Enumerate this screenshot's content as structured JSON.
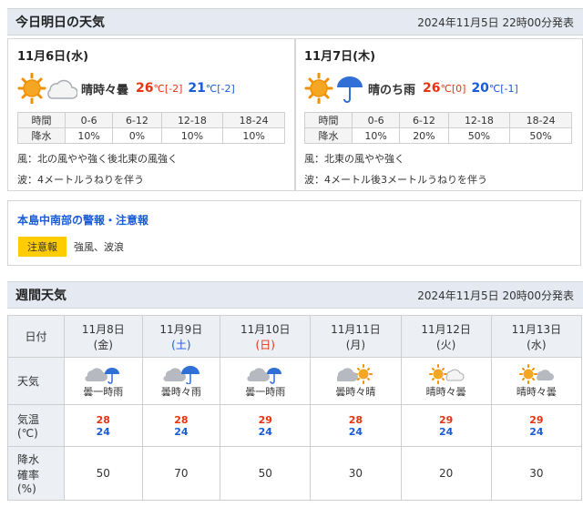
{
  "today_section": {
    "title": "今日明日の天気",
    "announced": "2024年11月5日 22時00分発表"
  },
  "days": [
    {
      "date": "11月6日(水)",
      "weather": "晴時々曇",
      "icon_names": [
        "sun-icon",
        "cloud-icon"
      ],
      "temp_max": "26",
      "temp_max_diff": "℃[-2]",
      "temp_min": "21",
      "temp_min_diff": "℃[-2]",
      "rain_header": [
        "時間",
        "0-6",
        "6-12",
        "12-18",
        "18-24"
      ],
      "rain_row": [
        "降水",
        "10%",
        "0%",
        "10%",
        "10%"
      ],
      "wind": "風：北の風やや強く後北東の風強く",
      "wave": "波：4メートルうねりを伴う"
    },
    {
      "date": "11月7日(木)",
      "weather": "晴のち雨",
      "icon_names": [
        "sun-icon",
        "umbrella-icon"
      ],
      "temp_max": "26",
      "temp_max_diff": "℃[0]",
      "temp_min": "20",
      "temp_min_diff": "℃[-1]",
      "rain_header": [
        "時間",
        "0-6",
        "6-12",
        "12-18",
        "18-24"
      ],
      "rain_row": [
        "降水",
        "10%",
        "20%",
        "50%",
        "50%"
      ],
      "wind": "風：北東の風やや強く",
      "wave": "波：4メートル後3メートルうねりを伴う"
    }
  ],
  "warning": {
    "title": "本島中南部の警報・注意報",
    "badge": "注意報",
    "text": "強風、波浪",
    "badge_color": "#ffcc00"
  },
  "weekly_section": {
    "title": "週間天気",
    "announced": "2024年11月5日 20時00分発表"
  },
  "weekly": {
    "row_labels": {
      "date": "日付",
      "weather": "天気",
      "temp_line1": "気温",
      "temp_line2": "(℃)",
      "pop_line1": "降水",
      "pop_line2": "確率",
      "pop_line3": "(%)"
    },
    "days": [
      {
        "date": "11月8日",
        "dow": "(金)",
        "dow_type": "weekday",
        "weather": "曇一時雨",
        "icons": [
          "cloud-icon",
          "umbrella-icon"
        ],
        "max": "28",
        "min": "24",
        "pop": "50"
      },
      {
        "date": "11月9日",
        "dow": "(土)",
        "dow_type": "sat",
        "weather": "曇時々雨",
        "icons": [
          "cloud-icon",
          "umbrella-icon"
        ],
        "max": "28",
        "min": "24",
        "pop": "70"
      },
      {
        "date": "11月10日",
        "dow": "(日)",
        "dow_type": "sun",
        "weather": "曇一時雨",
        "icons": [
          "cloud-icon",
          "umbrella-icon"
        ],
        "max": "29",
        "min": "24",
        "pop": "50"
      },
      {
        "date": "11月11日",
        "dow": "(月)",
        "dow_type": "weekday",
        "weather": "曇時々晴",
        "icons": [
          "cloud-icon",
          "sun-icon"
        ],
        "max": "28",
        "min": "24",
        "pop": "30"
      },
      {
        "date": "11月12日",
        "dow": "(火)",
        "dow_type": "weekday",
        "weather": "晴時々曇",
        "icons": [
          "sun-icon",
          "cloud-icon"
        ],
        "max": "29",
        "min": "24",
        "pop": "20"
      },
      {
        "date": "11月13日",
        "dow": "(水)",
        "dow_type": "weekday",
        "weather": "晴時々曇",
        "icons": [
          "sun-icon",
          "cloud-icon"
        ],
        "max": "29",
        "min": "24",
        "pop": "30"
      }
    ]
  },
  "colors": {
    "sun": "#f29100",
    "cloud": "#a9adb3",
    "umbrella": "#2f6fd6",
    "temp_max": "#e63312",
    "temp_min": "#1a5bd6"
  }
}
